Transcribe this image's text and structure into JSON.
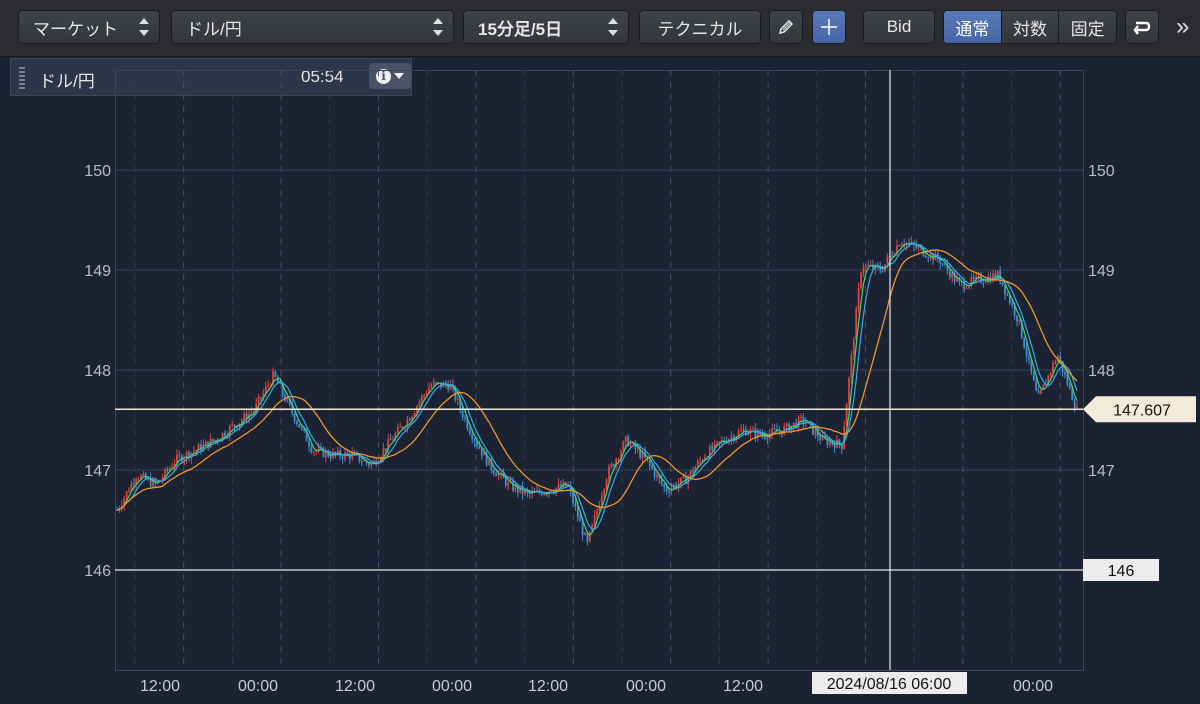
{
  "toolbar": {
    "market_select": "マーケット",
    "pair_select": "ドル/円",
    "period_select": "15分足/5日",
    "technical_button": "テクニカル",
    "bid_button": "Bid",
    "scale_modes": [
      "通常",
      "対数",
      "固定"
    ],
    "active_scale": "通常",
    "more_label": "»"
  },
  "info": {
    "pair": "ドル/円",
    "time": "05:54"
  },
  "crosshair": {
    "date_label": "2024/08/16 06:00"
  },
  "price_tags": {
    "current": "147.607",
    "cursor": "146"
  },
  "colors": {
    "background": "#1b2232",
    "up": "#e0443e",
    "down": "#3f8fd2",
    "ma_short": "#3fd47a",
    "ma_mid": "#3aa8f0",
    "ma_long": "#f0962a",
    "active": "#4f70b0"
  },
  "chart_data": {
    "type": "candlestick",
    "y_ticks": [
      "150",
      "149",
      "148",
      "147",
      "146"
    ],
    "x_ticks": [
      "12:00",
      "00:00",
      "12:00",
      "00:00",
      "12:00",
      "00:00",
      "12:00",
      "2024/08/16 06:00",
      "00:00"
    ],
    "ylim": [
      145,
      151
    ],
    "current_price": 147.607,
    "cursor_price": 146,
    "grid": true,
    "series": [
      {
        "values": [
          146.6,
          146.95,
          146.85,
          147.1,
          147.2,
          147.3,
          147.45,
          147.6,
          147.95,
          147.55,
          147.2,
          147.15,
          147.15,
          147.05,
          147.3,
          147.55,
          147.85,
          147.85,
          147.4,
          147.05,
          146.85,
          146.75,
          146.8,
          146.85,
          146.25,
          146.95,
          147.3,
          147.1,
          146.8,
          146.9,
          147.15,
          147.3,
          147.4,
          147.35,
          147.4,
          147.5,
          147.3,
          147.25,
          149.05,
          149.0,
          149.3,
          149.2,
          149.1,
          148.85,
          148.9,
          148.95,
          148.5,
          147.7,
          148.15,
          147.6
        ]
      }
    ]
  }
}
